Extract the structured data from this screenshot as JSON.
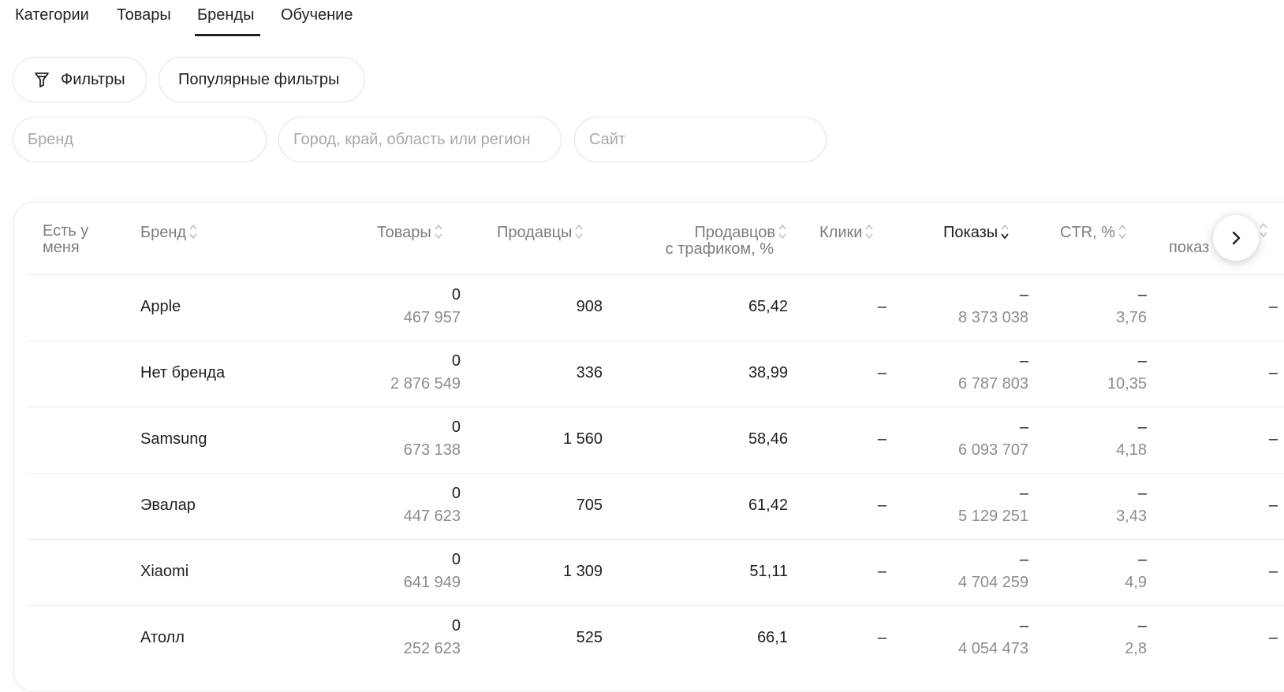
{
  "tabs": [
    {
      "label": "Категории"
    },
    {
      "label": "Товары"
    },
    {
      "label": "Бренды",
      "active": true
    },
    {
      "label": "Обучение"
    }
  ],
  "filters": {
    "filters_label": "Фильтры",
    "popular_label": "Популярные фильтры"
  },
  "inputs": {
    "brand_placeholder": "Бренд",
    "region_placeholder": "Город, край, область или регион",
    "site_placeholder": "Сайт"
  },
  "table": {
    "headers": {
      "mine_l1": "Есть у",
      "mine_l2": "меня",
      "brand": "Бренд",
      "products": "Товары",
      "sellers": "Продавцы",
      "traffic_l1": "Продавцов",
      "traffic_l2": "с трафиком, %",
      "clicks": "Клики",
      "impressions": "Показы",
      "ctr": "CTR, %",
      "partial": "показ"
    },
    "rows": [
      {
        "brand": "Apple",
        "products_top": "0",
        "products": "467 957",
        "sellers": "908",
        "traffic": "65,42",
        "clicks": "–",
        "impressions_top": "–",
        "impressions": "8 373 038",
        "ctr_top": "–",
        "ctr": "3,76",
        "last": "–"
      },
      {
        "brand": "Нет бренда",
        "products_top": "0",
        "products": "2 876 549",
        "sellers": "336",
        "traffic": "38,99",
        "clicks": "–",
        "impressions_top": "–",
        "impressions": "6 787 803",
        "ctr_top": "–",
        "ctr": "10,35",
        "last": "–"
      },
      {
        "brand": "Samsung",
        "products_top": "0",
        "products": "673 138",
        "sellers": "1 560",
        "traffic": "58,46",
        "clicks": "–",
        "impressions_top": "–",
        "impressions": "6 093 707",
        "ctr_top": "–",
        "ctr": "4,18",
        "last": "–"
      },
      {
        "brand": "Эвалар",
        "products_top": "0",
        "products": "447 623",
        "sellers": "705",
        "traffic": "61,42",
        "clicks": "–",
        "impressions_top": "–",
        "impressions": "5 129 251",
        "ctr_top": "–",
        "ctr": "3,43",
        "last": "–"
      },
      {
        "brand": "Xiaomi",
        "products_top": "0",
        "products": "641 949",
        "sellers": "1 309",
        "traffic": "51,11",
        "clicks": "–",
        "impressions_top": "–",
        "impressions": "4 704 259",
        "ctr_top": "–",
        "ctr": "4,9",
        "last": "–"
      },
      {
        "brand": "Атолл",
        "products_top": "0",
        "products": "252 623",
        "sellers": "525",
        "traffic": "66,1",
        "clicks": "–",
        "impressions_top": "–",
        "impressions": "4 054 473",
        "ctr_top": "–",
        "ctr": "2,8",
        "last": "–"
      }
    ]
  },
  "icons": {
    "filter": "funnel-icon",
    "sort": "sort-icon",
    "next": "chevron-right-icon"
  },
  "colors": {
    "text": "#1f1f1f",
    "muted": "#8c8c8c",
    "border": "#e2e2e2"
  }
}
